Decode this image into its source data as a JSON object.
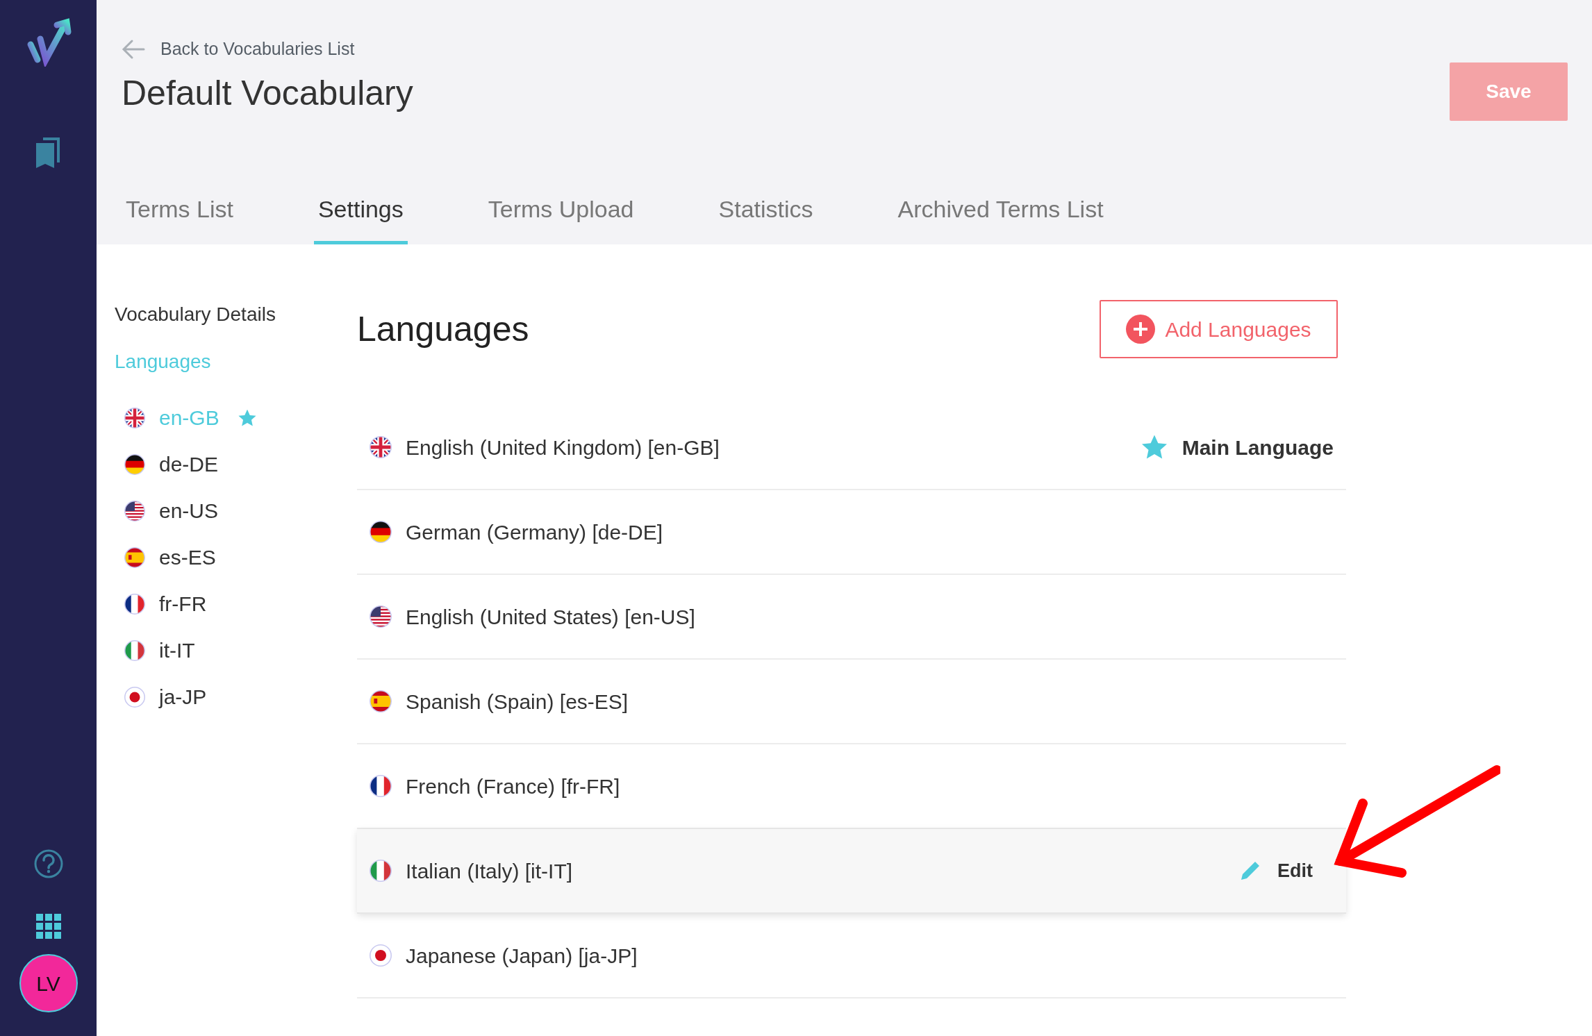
{
  "header": {
    "back_link": "Back to Vocabularies List",
    "title": "Default Vocabulary",
    "save_button": "Save"
  },
  "tabs": [
    {
      "label": "Terms List",
      "selected": false
    },
    {
      "label": "Settings",
      "selected": true
    },
    {
      "label": "Terms Upload",
      "selected": false
    },
    {
      "label": "Statistics",
      "selected": false
    },
    {
      "label": "Archived Terms List",
      "selected": false
    }
  ],
  "side_nav": {
    "items": [
      {
        "label": "Vocabulary Details",
        "selected": false
      },
      {
        "label": "Languages",
        "selected": true
      }
    ],
    "languages": [
      {
        "code": "en-GB",
        "kind": "gb",
        "selected": true,
        "main": true
      },
      {
        "code": "de-DE",
        "kind": "de",
        "selected": false,
        "main": false
      },
      {
        "code": "en-US",
        "kind": "us",
        "selected": false,
        "main": false
      },
      {
        "code": "es-ES",
        "kind": "es",
        "selected": false,
        "main": false
      },
      {
        "code": "fr-FR",
        "kind": "fr",
        "selected": false,
        "main": false
      },
      {
        "code": "it-IT",
        "kind": "it",
        "selected": false,
        "main": false
      },
      {
        "code": "ja-JP",
        "kind": "jp",
        "selected": false,
        "main": false
      }
    ]
  },
  "languages_panel": {
    "heading": "Languages",
    "add_button": "Add Languages",
    "rows": [
      {
        "name": "English (United Kingdom) [en-GB]",
        "kind": "gb",
        "main": true,
        "main_label": "Main Language",
        "hovered": false
      },
      {
        "name": "German (Germany) [de-DE]",
        "kind": "de",
        "main": false,
        "hovered": false
      },
      {
        "name": "English (United States) [en-US]",
        "kind": "us",
        "main": false,
        "hovered": false
      },
      {
        "name": "Spanish (Spain) [es-ES]",
        "kind": "es",
        "main": false,
        "hovered": false
      },
      {
        "name": "French (France) [fr-FR]",
        "kind": "fr",
        "main": false,
        "hovered": false
      },
      {
        "name": "Italian (Italy) [it-IT]",
        "kind": "it",
        "main": false,
        "hovered": true,
        "action_label": "Edit"
      },
      {
        "name": "Japanese (Japan) [ja-JP]",
        "kind": "jp",
        "main": false,
        "hovered": false
      }
    ]
  },
  "user": {
    "initials": "LV"
  }
}
